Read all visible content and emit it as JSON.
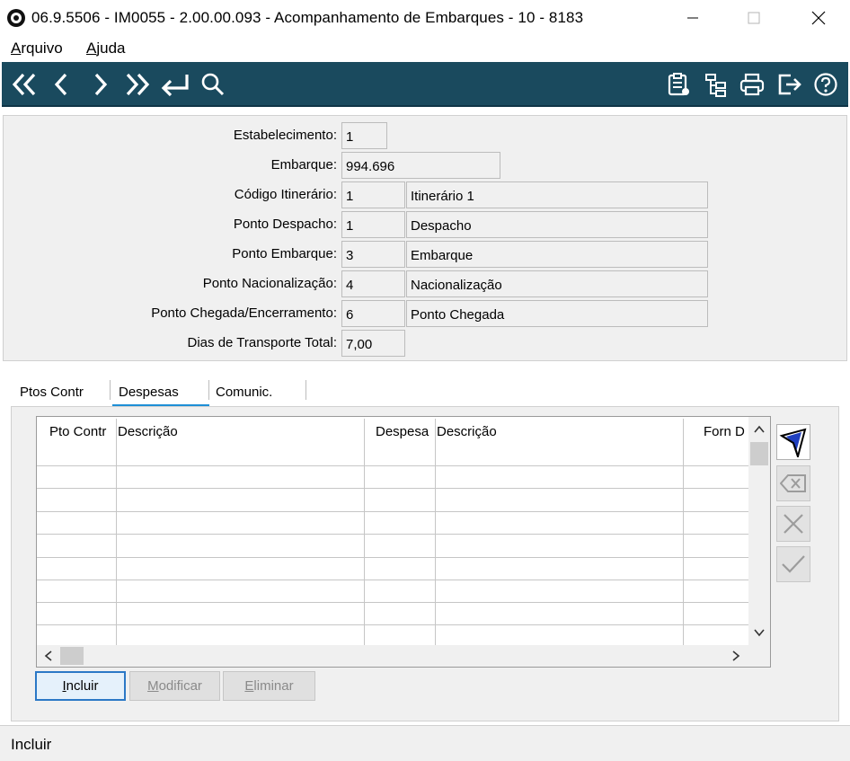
{
  "window": {
    "title": "06.9.5506 - IM0055 - 2.00.00.093 - Acompanhamento de Embarques - 10 - 8183"
  },
  "menu": {
    "items": [
      {
        "label": "Arquivo",
        "mnemonic": "A",
        "rest": "rquivo"
      },
      {
        "label": "Ajuda",
        "mnemonic": "A",
        "rest": "juda"
      }
    ]
  },
  "toolbar": {
    "background": "#1a4a5e",
    "nav_icons": [
      "first-record-icon",
      "previous-record-icon",
      "next-record-icon",
      "last-record-icon",
      "goto-return-icon",
      "search-icon"
    ],
    "right_icons": [
      "clipboard-list-icon",
      "hierarchy-icon",
      "print-icon",
      "exit-icon",
      "help-icon"
    ]
  },
  "form": {
    "estabelecimento": {
      "label": "Estabelecimento:",
      "value": "1"
    },
    "embarque": {
      "label": "Embarque:",
      "value": "994.696"
    },
    "codigo_itinerario": {
      "label": "Código Itinerário:",
      "code": "1",
      "desc": "Itinerário 1"
    },
    "ponto_despacho": {
      "label": "Ponto Despacho:",
      "code": "1",
      "desc": "Despacho"
    },
    "ponto_embarque": {
      "label": "Ponto Embarque:",
      "code": "3",
      "desc": "Embarque"
    },
    "ponto_nacionalizacao": {
      "label": "Ponto Nacionalização:",
      "code": "4",
      "desc": "Nacionalização"
    },
    "ponto_chegada": {
      "label": "Ponto Chegada/Encerramento:",
      "code": "6",
      "desc": "Ponto Chegada"
    },
    "dias_transporte": {
      "label": "Dias de Transporte Total:",
      "value": "7,00"
    }
  },
  "tabs": [
    {
      "label": "Ptos Contr",
      "active": false
    },
    {
      "label": "Despesas",
      "active": true
    },
    {
      "label": "Comunic.",
      "active": false
    }
  ],
  "grid": {
    "columns": [
      "Pto Contr",
      "Descrição",
      "Despesa",
      "Descrição",
      "Forn D"
    ],
    "rows": []
  },
  "side_buttons": [
    "filter-icon",
    "clear-icon",
    "cancel-icon",
    "confirm-icon"
  ],
  "actions": {
    "incluir": {
      "label": "Incluir",
      "mnemonic": "I",
      "rest": "ncluir",
      "enabled": true
    },
    "modificar": {
      "label": "Modificar",
      "mnemonic": "M",
      "rest": "odificar",
      "enabled": false
    },
    "eliminar": {
      "label": "Eliminar",
      "mnemonic": "E",
      "rest": "liminar",
      "enabled": false
    }
  },
  "status": {
    "text": "Incluir"
  }
}
